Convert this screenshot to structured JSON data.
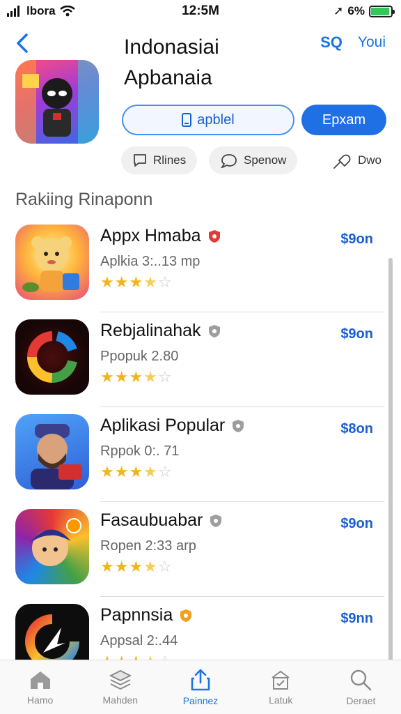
{
  "status_bar": {
    "carrier": "lbora",
    "time": "12:5M",
    "battery": "6%"
  },
  "header": {
    "title_line1": "Indonasiai",
    "title_line2": "Apbanaia",
    "action_1": "SQ",
    "action_2": "Youi"
  },
  "buttons": {
    "outline_label": "apblel",
    "solid_label": "Epxam"
  },
  "chips": [
    {
      "label": "Rlines",
      "icon": "chat-icon"
    },
    {
      "label": "Spenow",
      "icon": "comment-icon"
    },
    {
      "label": "Dwo",
      "icon": "pin-icon"
    }
  ],
  "section_title": "Rakiing Rinaponn",
  "apps": [
    {
      "name": "Appx Hmaba",
      "subtitle": "Aplkia 3:..13 mp",
      "price": "$9on",
      "rating": 3.5,
      "badge_color": "#e53935"
    },
    {
      "name": "Rebjalinahak",
      "subtitle": "Ppopuk 2.80",
      "price": "$9on",
      "rating": 3.5,
      "badge_color": "#9e9e9e"
    },
    {
      "name": "Aplikasi Popular",
      "subtitle": "Rppok 0:. 71",
      "price": "$8on",
      "rating": 3.5,
      "badge_color": "#9e9e9e"
    },
    {
      "name": "Fasaubuabar",
      "subtitle": "Ropen 2:33 arp",
      "price": "$9on",
      "rating": 3.5,
      "badge_color": "#9e9e9e"
    },
    {
      "name": "Papnnsia",
      "subtitle": "Appsal 2:.44",
      "price": "$9nn",
      "rating": 3.5,
      "badge_color": "#f0a020"
    }
  ],
  "tabs": [
    {
      "label": "Hamo",
      "icon": "home-icon",
      "active": false
    },
    {
      "label": "Mahden",
      "icon": "layers-icon",
      "active": false
    },
    {
      "label": "Painnez",
      "icon": "share-icon",
      "active": true
    },
    {
      "label": "Latuk",
      "icon": "store-icon",
      "active": false
    },
    {
      "label": "Deraet",
      "icon": "search-icon",
      "active": false
    }
  ]
}
